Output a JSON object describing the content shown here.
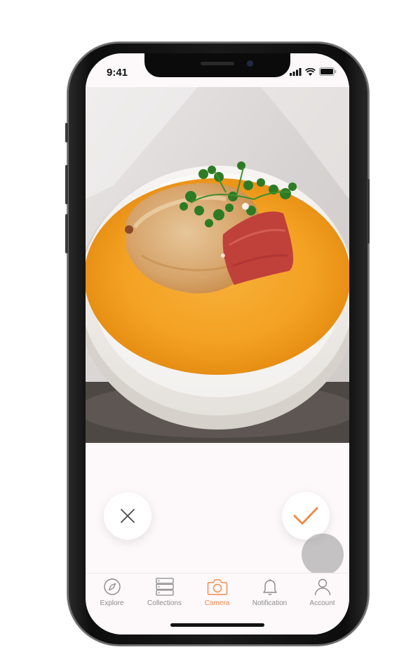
{
  "status_bar": {
    "time": "9:41"
  },
  "photo": {
    "subject": "food-photo"
  },
  "actions": {
    "discard_icon": "close-icon",
    "confirm_icon": "checkmark-icon"
  },
  "tab_bar": {
    "active": "Camera",
    "items": [
      {
        "label": "Explore",
        "icon": "compass-icon"
      },
      {
        "label": "Collections",
        "icon": "collections-icon"
      },
      {
        "label": "Camera",
        "icon": "camera-icon"
      },
      {
        "label": "Notification",
        "icon": "bell-icon"
      },
      {
        "label": "Account",
        "icon": "user-icon"
      }
    ]
  },
  "colors": {
    "accent": "#ef8a4a",
    "inactive": "#8a8a8a",
    "background": "#fdf9fb"
  }
}
